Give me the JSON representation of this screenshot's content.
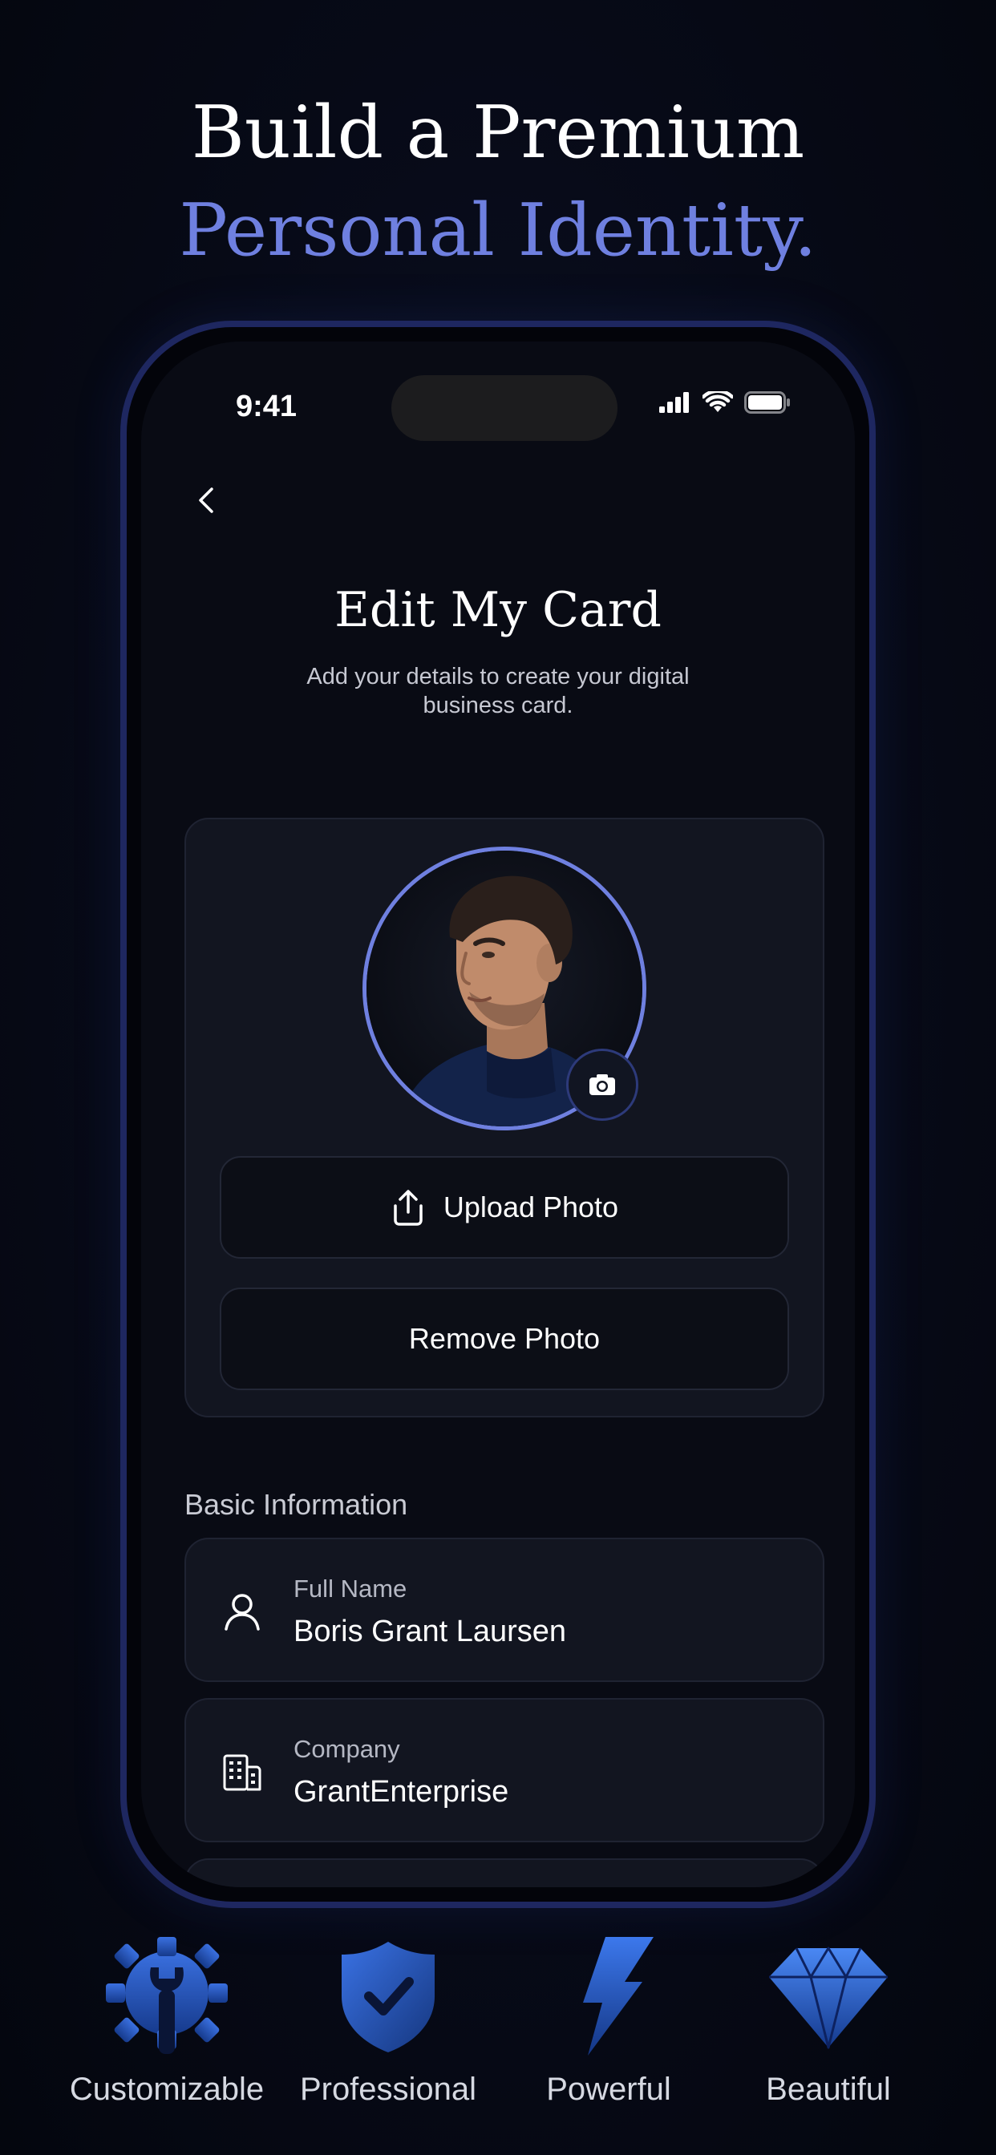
{
  "headline": {
    "line1": "Build a Premium",
    "line2": "Personal Identity."
  },
  "status_bar": {
    "time": "9:41"
  },
  "screen": {
    "title": "Edit My Card",
    "subtitle": "Add your details to create your digital business card."
  },
  "photo": {
    "upload_label": "Upload Photo",
    "remove_label": "Remove Photo"
  },
  "basic_info": {
    "section_label": "Basic Information",
    "fields": [
      {
        "label": "Full Name",
        "value": "Boris Grant Laursen",
        "icon": "user-icon"
      },
      {
        "label": "Company",
        "value": "GrantEnterprise",
        "icon": "building-icon"
      }
    ]
  },
  "features": [
    {
      "label": "Customizable",
      "icon": "gear-wrench-icon"
    },
    {
      "label": "Professional",
      "icon": "shield-check-icon"
    },
    {
      "label": "Powerful",
      "icon": "lightning-icon"
    },
    {
      "label": "Beautiful",
      "icon": "diamond-icon"
    }
  ],
  "colors": {
    "accent": "#6f80e0",
    "background": "#070a17",
    "card": "#121520"
  }
}
